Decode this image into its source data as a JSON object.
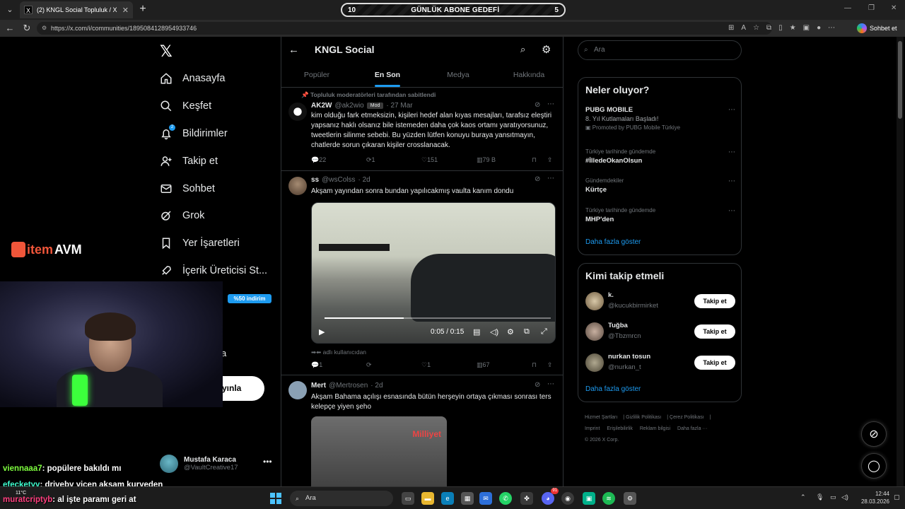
{
  "browser": {
    "tab_title": "(2) KNGL Social Topluluk / X",
    "tab_close": "✕",
    "new_tab": "+",
    "url": "https://x.com/i/communities/1895084128954933746",
    "chat_label": "Sohbet et",
    "window_controls": [
      "—",
      "❐",
      "✕"
    ]
  },
  "sub_goal": {
    "current": "10",
    "title": "GÜNLÜK ABONE GEDEFİ",
    "target": "5"
  },
  "nav": {
    "items": [
      {
        "label": "Anasayfa",
        "icon": "home-icon"
      },
      {
        "label": "Keşfet",
        "icon": "search-icon"
      },
      {
        "label": "Bildirimler",
        "icon": "bell-icon",
        "badge": "2"
      },
      {
        "label": "Takip et",
        "icon": "person-add-icon"
      },
      {
        "label": "Sohbet",
        "icon": "mail-icon"
      },
      {
        "label": "Grok",
        "icon": "grok-icon"
      },
      {
        "label": "Yer İşaretleri",
        "icon": "bookmark-icon"
      },
      {
        "label": "İçerik Üreticisi St...",
        "icon": "rocket-icon"
      }
    ],
    "discount": "%50 indirim",
    "partial_a": "a",
    "post_partial": "yınla"
  },
  "profile": {
    "name": "Mustafa Karaca",
    "handle": "@VaultCreative17",
    "more": "•••"
  },
  "overlay": {
    "brand_item": "item",
    "brand_avm": "AVM",
    "weather": "11°C",
    "chat": [
      {
        "user": "viennaaa7",
        "msg": ": popülere bakıldı mı",
        "color": "#7fff3f"
      },
      {
        "user": "efecketyy",
        "msg": ": driveby yicen aksam kuryeden",
        "color": "#3fffd0"
      },
      {
        "user": "muratcriptyb",
        "msg": ": al işte paramı geri at",
        "color": "#ff3f7f"
      }
    ]
  },
  "community": {
    "title": "KNGL Social",
    "tabs": [
      "Popüler",
      "En Son",
      "Medya",
      "Hakkında"
    ],
    "active_tab": 1
  },
  "tweets": [
    {
      "pinned": "Topluluk moderatörleri tarafından sabitlendi",
      "name": "AK2W",
      "handle": "@ak2wio",
      "mod": "Mod",
      "time": "· 27 Mar",
      "text": "kim olduğu fark etmeksizin, kişileri hedef alan kıyas mesajları, tarafsız eleştiri yapsanız haklı olsanız bile istemeden daha çok kaos ortamı yaratıyorsunuz, tweetlerin silinme sebebi. Bu yüzden lütfen konuyu buraya yansıtmayın, chatlerde sorun çıkaran kişiler crosslanacak.",
      "replies": "22",
      "reposts": "1",
      "likes": "151",
      "views": "79 B"
    },
    {
      "name": "ss",
      "handle": "@wsColss",
      "time": "· 2d",
      "text": "Akşam yayından sonra bundan yapılıcakmış vaulta kanım dondu",
      "video_time": "0:05 / 0:15",
      "video_progress": 0.35,
      "subtext": "➡⬅ adlı kullanıcıdan",
      "replies": "1",
      "reposts": "",
      "likes": "1",
      "views": "67"
    },
    {
      "name": "Mert",
      "handle": "@Mertrosen",
      "time": "· 2d",
      "text": "Akşam Bahama açılışı esnasında bütün herşeyin ortaya çıkması sonrası ters kelepçe yiyen şeho",
      "image_watermark": "Milliyet"
    }
  ],
  "right": {
    "search_placeholder": "Ara",
    "trends_title": "Neler oluyor?",
    "trends": [
      {
        "context": "",
        "title": "PUBG MOBILE",
        "sub": "8. Yıl Kutlamaları Başladı!",
        "promo": "Promoted by PUBG Mobile Türkiye"
      },
      {
        "context": "Türkiye tarihinde gündemde",
        "title": "#İlledeOkanOlsun",
        "sub": "",
        "promo": ""
      },
      {
        "context": "Gündemdekiler",
        "title": "Kürtçe",
        "sub": "",
        "promo": ""
      },
      {
        "context": "Türkiye tarihinde gündemde",
        "title": "MHP'den",
        "sub": "",
        "promo": ""
      }
    ],
    "show_more": "Daha fazla göster",
    "who_title": "Kimi takip etmeli",
    "who": [
      {
        "name": "k.",
        "handle": "@kucukbirmirket"
      },
      {
        "name": "Tuğba",
        "handle": "@Tbzmrcn"
      },
      {
        "name": "nurkan tosun",
        "handle": "@nurkan_t"
      }
    ],
    "follow_label": "Takip et",
    "footer": [
      "Hizmet Şartları",
      "Gizlilik Politikası",
      "Çerez Politikası",
      "Imprint",
      "Erişilebilirlik",
      "Reklam bilgisi",
      "Daha fazla ···",
      "© 2026 X Corp."
    ]
  },
  "taskbar": {
    "search": "Ara",
    "time": "12:44",
    "date": "28.03.2026",
    "notification_count": "91"
  }
}
